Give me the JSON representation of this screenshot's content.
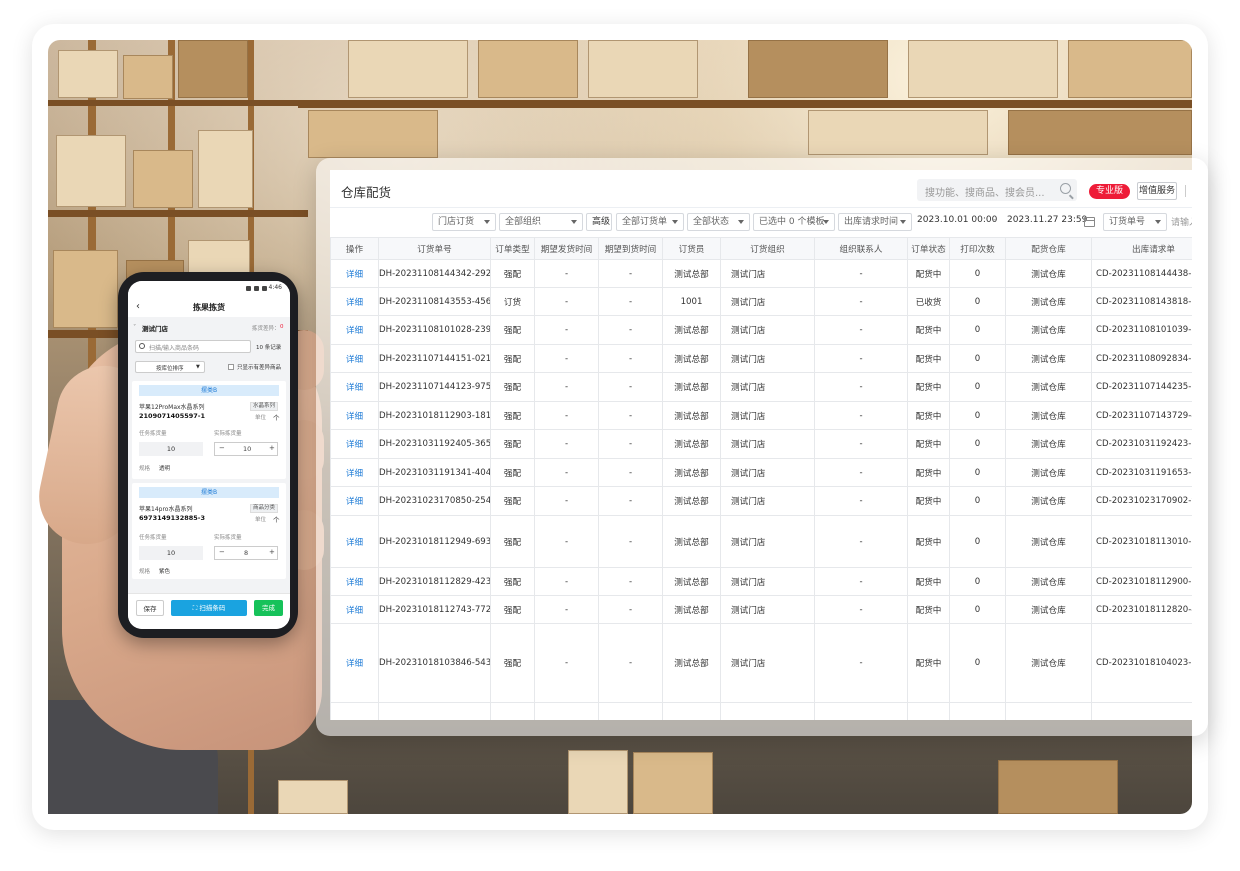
{
  "desktop": {
    "title": "仓库配货",
    "search_placeholder": "搜功能、搜商品、搜会员...",
    "pro_badge": "专业版",
    "value_added": "增值服务",
    "filters": {
      "store_order": "门店订货",
      "all_orgs": "全部组织",
      "advanced": "高级",
      "all_orders": "全部订货单",
      "all_status": "全部状态",
      "template": "已选中 0 个模板",
      "request_time": "出库请求时间",
      "date_from": "2023.10.01 00:00",
      "dash": "-",
      "date_to": "2023.11.27 23:59",
      "order_no": "订货单号",
      "input_placeholder": "请输入"
    },
    "columns": [
      "操作",
      "订货单号",
      "订单类型",
      "期望发货时间",
      "期望到货时间",
      "订货员",
      "订货组织",
      "组织联系人",
      "订单状态",
      "打印次数",
      "配货仓库",
      "出库请求单"
    ],
    "rows": [
      {
        "op": "详细",
        "no": "DH-20231108144342-292",
        "type": "强配",
        "ship": "-",
        "arrive": "-",
        "clerk": "测试总部",
        "org": "测试门店",
        "contact": "-",
        "status": "配货中",
        "print": "0",
        "wh": "测试仓库",
        "req": "CD-20231108144438-782"
      },
      {
        "op": "详细",
        "no": "DH-20231108143553-456",
        "type": "订货",
        "ship": "-",
        "arrive": "-",
        "clerk": "1001",
        "org": "测试门店",
        "contact": "-",
        "status": "已收货",
        "print": "0",
        "wh": "测试仓库",
        "req": "CD-20231108143818-528"
      },
      {
        "op": "详细",
        "no": "DH-20231108101028-239",
        "type": "强配",
        "ship": "-",
        "arrive": "-",
        "clerk": "测试总部",
        "org": "测试门店",
        "contact": "-",
        "status": "配货中",
        "print": "0",
        "wh": "测试仓库",
        "req": "CD-20231108101039-804"
      },
      {
        "op": "详细",
        "no": "DH-20231107144151-021",
        "type": "强配",
        "ship": "-",
        "arrive": "-",
        "clerk": "测试总部",
        "org": "测试门店",
        "contact": "-",
        "status": "配货中",
        "print": "0",
        "wh": "测试仓库",
        "req": "CD-20231108092834-670"
      },
      {
        "op": "详细",
        "no": "DH-20231107144123-975",
        "type": "强配",
        "ship": "-",
        "arrive": "-",
        "clerk": "测试总部",
        "org": "测试门店",
        "contact": "-",
        "status": "配货中",
        "print": "0",
        "wh": "测试仓库",
        "req": "CD-20231107144235-620"
      },
      {
        "op": "详细",
        "no": "DH-20231018112903-181",
        "type": "强配",
        "ship": "-",
        "arrive": "-",
        "clerk": "测试总部",
        "org": "测试门店",
        "contact": "-",
        "status": "配货中",
        "print": "0",
        "wh": "测试仓库",
        "req": "CD-20231107143729-421"
      },
      {
        "op": "详细",
        "no": "DH-20231031192405-365",
        "type": "强配",
        "ship": "-",
        "arrive": "-",
        "clerk": "测试总部",
        "org": "测试门店",
        "contact": "-",
        "status": "配货中",
        "print": "0",
        "wh": "测试仓库",
        "req": "CD-20231031192423-283"
      },
      {
        "op": "详细",
        "no": "DH-20231031191341-404",
        "type": "强配",
        "ship": "-",
        "arrive": "-",
        "clerk": "测试总部",
        "org": "测试门店",
        "contact": "-",
        "status": "配货中",
        "print": "0",
        "wh": "测试仓库",
        "req": "CD-20231031191653-804"
      },
      {
        "op": "详细",
        "no": "DH-20231023170850-254",
        "type": "强配",
        "ship": "-",
        "arrive": "-",
        "clerk": "测试总部",
        "org": "测试门店",
        "contact": "-",
        "status": "配货中",
        "print": "0",
        "wh": "测试仓库",
        "req": "CD-20231023170902-936"
      },
      {
        "op": "详细",
        "no": "DH-20231018112949-693",
        "type": "强配",
        "ship": "-",
        "arrive": "-",
        "clerk": "测试总部",
        "org": "测试门店",
        "contact": "-",
        "status": "配货中",
        "print": "0",
        "wh": "测试仓库",
        "req": "CD-20231018113010-810"
      },
      {
        "op": "详细",
        "no": "DH-20231018112829-423",
        "type": "强配",
        "ship": "-",
        "arrive": "-",
        "clerk": "测试总部",
        "org": "测试门店",
        "contact": "-",
        "status": "配货中",
        "print": "0",
        "wh": "测试仓库",
        "req": "CD-20231018112900-742"
      },
      {
        "op": "详细",
        "no": "DH-20231018112743-772",
        "type": "强配",
        "ship": "-",
        "arrive": "-",
        "clerk": "测试总部",
        "org": "测试门店",
        "contact": "-",
        "status": "配货中",
        "print": "0",
        "wh": "测试仓库",
        "req": "CD-20231018112820-449"
      },
      {
        "op": "详细",
        "no": "DH-20231018103846-543",
        "type": "强配",
        "ship": "-",
        "arrive": "-",
        "clerk": "测试总部",
        "org": "测试门店",
        "contact": "-",
        "status": "配货中",
        "print": "0",
        "wh": "测试仓库",
        "req": "CD-20231018104023-349"
      }
    ]
  },
  "mobile": {
    "time": "4:46",
    "back": "‹",
    "title": "拣果拣货",
    "store": "测试门店",
    "pick_count_label": "拣货差异：",
    "pick_count_value": "0",
    "search_placeholder": "扫描/输入商品条码",
    "record_count": "10 条记录",
    "sort": "按库位排序",
    "only_diff": "只显示有差异商品",
    "items": [
      {
        "zone": "摆类B",
        "name": "苹果12ProMax水晶系列",
        "series": "水晶系列",
        "barcode": "2109071405597-1",
        "unit_label": "单位",
        "unit": "个",
        "task_label": "任务拣货量",
        "task_qty": "10",
        "actual_label": "实际拣货量",
        "actual_qty": "10",
        "spec_label": "规格",
        "spec": "透明"
      },
      {
        "zone": "摆类B",
        "name": "苹果14pro水晶系列",
        "series": "商品分类",
        "barcode": "6973149132885-3",
        "unit_label": "单位",
        "unit": "个",
        "task_label": "任务拣货量",
        "task_qty": "10",
        "actual_label": "实际拣货量",
        "actual_qty": "8",
        "spec_label": "规格",
        "spec": "紫色"
      }
    ],
    "minus": "−",
    "plus": "+",
    "save": "保存",
    "scan": "扫描条码",
    "done": "完成"
  },
  "colors": {
    "accent": "#1e7bd6",
    "scan": "#1aa3e0",
    "done": "#16c25a",
    "badge": "#ee1c38"
  }
}
